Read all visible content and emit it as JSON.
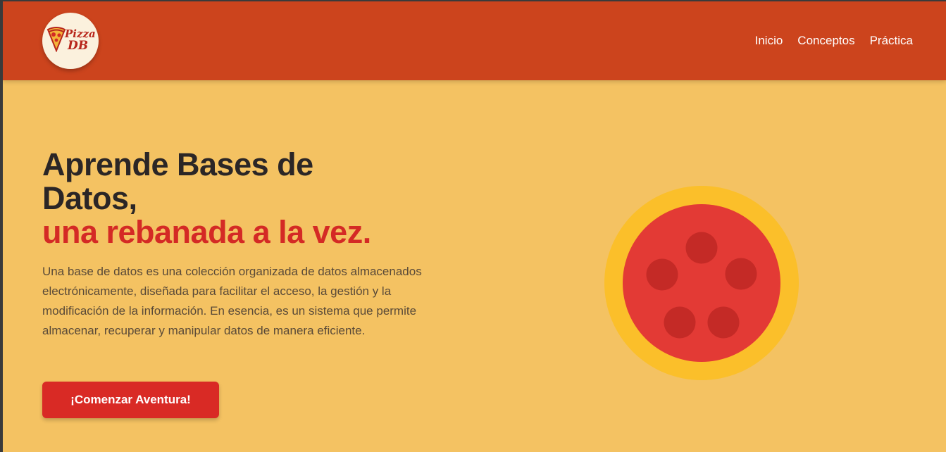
{
  "header": {
    "logo_text_1": "Pizza",
    "logo_text_2": "DB",
    "nav": [
      {
        "label": "Inicio"
      },
      {
        "label": "Conceptos"
      },
      {
        "label": "Práctica"
      }
    ]
  },
  "hero": {
    "title_line1": "Aprende Bases de",
    "title_line2": "Datos,",
    "title_accent": "una rebanada a la vez.",
    "description": "Una base de datos es una colección organizada de datos almacenados electrónicamente, diseñada para facilitar el acceso, la gestión y la modificación de la información. En esencia, es un sistema que permite almacenar, recuperar y manipular datos de manera eficiente.",
    "cta_label": "¡Comenzar Aventura!"
  },
  "colors": {
    "header_bg": "#cc441d",
    "page_bg": "#f4c262",
    "accent": "#d42a25",
    "crust": "#fbbf2a",
    "sauce": "#e33a35",
    "pepperoni": "#c42a26"
  }
}
